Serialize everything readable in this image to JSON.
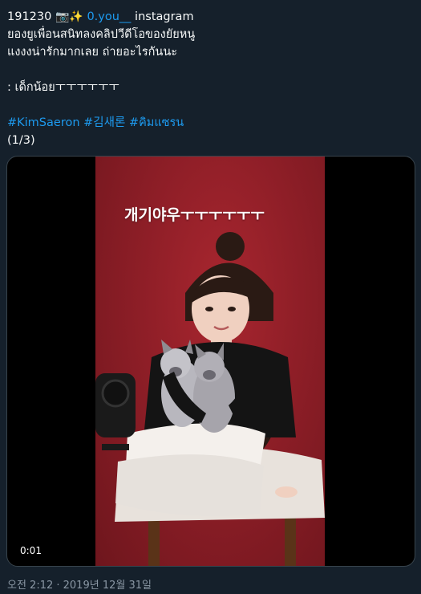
{
  "tweet": {
    "line1_prefix": "191230 ",
    "line1_emoji": "📷✨",
    "line1_link": " 0.you__",
    "line1_suffix": " instagram",
    "line2": "ยองยูเพื่อนสนิทลงคลิปวีดีโอของยัยหนู",
    "line3": "แงงงน่ารักมากเลย ถ่ายอะไรกันนะ",
    "line5": ": เด็กน้อยㅜㅜㅜㅜㅜㅜ",
    "hashtags": "#KimSaeron #김새론 #คิมแซรน",
    "counter": "(1/3)"
  },
  "video": {
    "caption": "개기야우ㅜㅜㅜㅜㅜㅜ",
    "timestamp": "0:01"
  },
  "meta": {
    "posted": "오전 2:12 · 2019년 12월 31일"
  },
  "colors": {
    "background": "#15202b",
    "link": "#1d9bf0",
    "backdrop": "#8e1e27"
  }
}
